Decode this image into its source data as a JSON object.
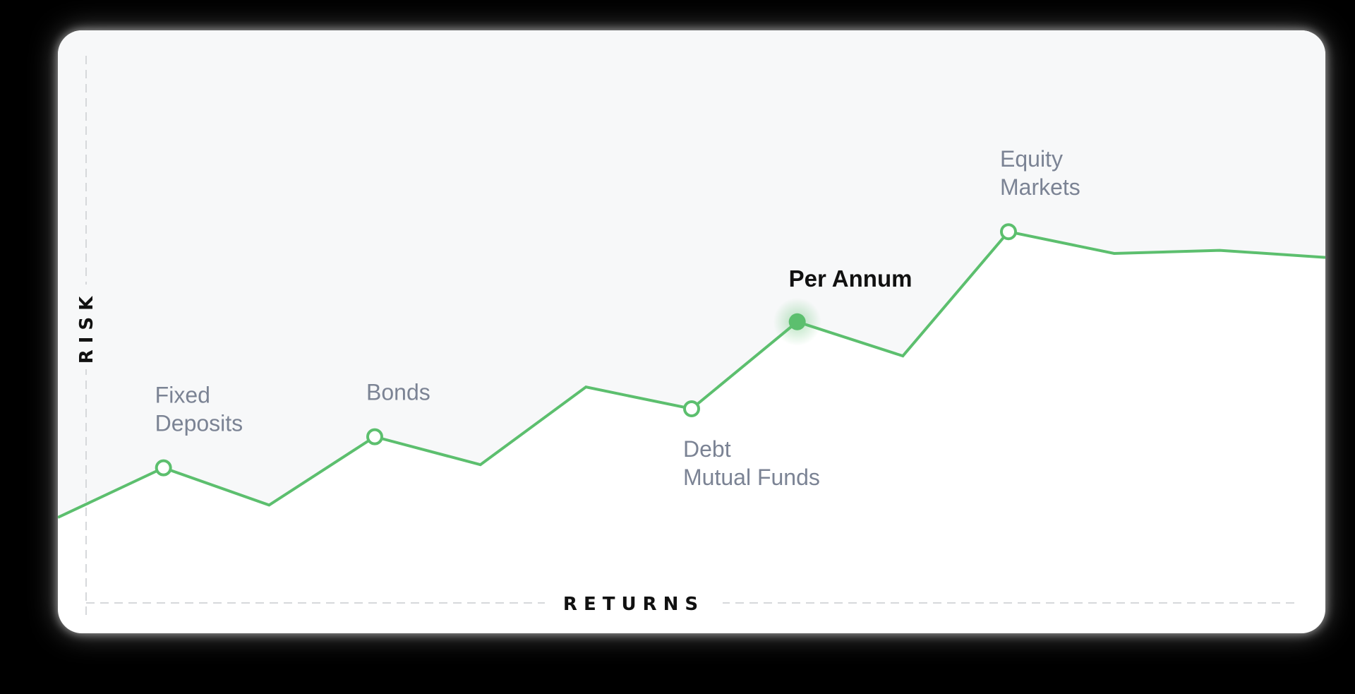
{
  "chart_data": {
    "type": "line",
    "xlabel": "RETURNS",
    "ylabel": "RISK",
    "grid": false,
    "legend": "none",
    "x": [
      0,
      1,
      2,
      3,
      4,
      5,
      6,
      7,
      8,
      9,
      10,
      11,
      12
    ],
    "series": [
      {
        "values": [
          0,
          1.6,
          0.4,
          2.6,
          1.7,
          4.2,
          3.5,
          6.3,
          5.2,
          9.2,
          8.5,
          8.6
        ]
      }
    ],
    "ylim": [
      0,
      10
    ],
    "markers": [
      {
        "label": "Fixed\nDeposits",
        "lines": [
          "Fixed",
          "Deposits"
        ],
        "point_index": 1,
        "style": "hollow",
        "label_position": "above"
      },
      {
        "label": "Bonds",
        "lines": [
          "Bonds"
        ],
        "point_index": 3,
        "style": "hollow",
        "label_position": "above"
      },
      {
        "label": "Debt\nMutual Funds",
        "lines": [
          "Debt",
          "Mutual Funds"
        ],
        "point_index": 6,
        "style": "hollow",
        "label_position": "below"
      },
      {
        "label": "Per Annum",
        "lines": [
          "Per Annum"
        ],
        "point_index": 7,
        "style": "filled-highlight",
        "label_position": "above"
      },
      {
        "label": "Equity\nMarkets",
        "lines": [
          "Equity",
          "Markets"
        ],
        "point_index": 9,
        "style": "hollow",
        "label_position": "above"
      }
    ]
  },
  "colors": {
    "line": "#5cbf6e",
    "upper_area": "#f7f8f9",
    "card": "#ffffff",
    "label": "#7b8394",
    "highlight_label": "#111111",
    "axis": "#d6d8db"
  }
}
